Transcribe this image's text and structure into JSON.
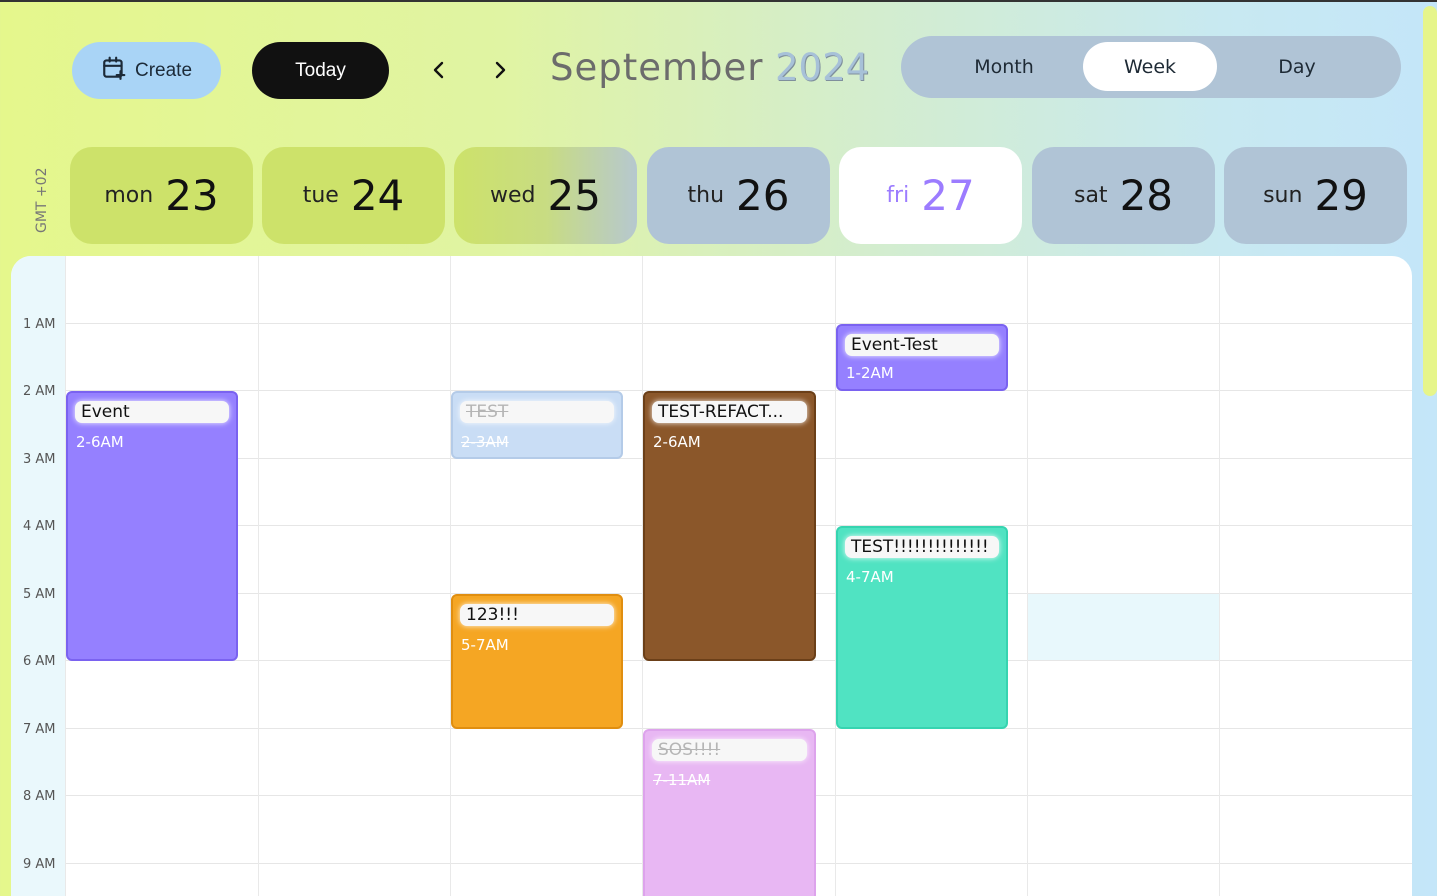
{
  "header": {
    "create_label": "Create",
    "today_label": "Today",
    "month": "September",
    "year": "2024",
    "views": [
      "Month",
      "Week",
      "Day"
    ],
    "active_view": "Week"
  },
  "timezone": "GMT +02",
  "days": [
    {
      "name": "mon",
      "num": "23"
    },
    {
      "name": "tue",
      "num": "24"
    },
    {
      "name": "wed",
      "num": "25"
    },
    {
      "name": "thu",
      "num": "26"
    },
    {
      "name": "fri",
      "num": "27"
    },
    {
      "name": "sat",
      "num": "28"
    },
    {
      "name": "sun",
      "num": "29"
    }
  ],
  "hours": [
    "1 AM",
    "2 AM",
    "3 AM",
    "4 AM",
    "5 AM",
    "6 AM",
    "7 AM",
    "8 AM",
    "9 AM"
  ],
  "events": [
    {
      "title": "Event",
      "time": "2-6AM",
      "color": "#9580ff",
      "done": false
    },
    {
      "title": "TEST",
      "time": "2-3AM",
      "color": "#c9ddf5",
      "done": true
    },
    {
      "title": "123!!!",
      "time": "5-7AM",
      "color": "#f5a623",
      "done": false
    },
    {
      "title": "TEST-REFACT...",
      "time": "2-6AM",
      "color": "#8b572a",
      "done": false
    },
    {
      "title": "SOS!!!!",
      "time": "7-11AM",
      "color": "#e8b7f3",
      "done": true
    },
    {
      "title": "Event-Test",
      "time": "1-2AM",
      "color": "#9580ff",
      "done": false
    },
    {
      "title": "TEST!!!!!!!!!!!!!!",
      "time": "4-7AM",
      "color": "#50e3c2",
      "done": false
    }
  ],
  "colors": {
    "today_accent": "#9c7cff",
    "day_card_green": "#cde26a",
    "day_card_blue": "#b0c4d6"
  }
}
